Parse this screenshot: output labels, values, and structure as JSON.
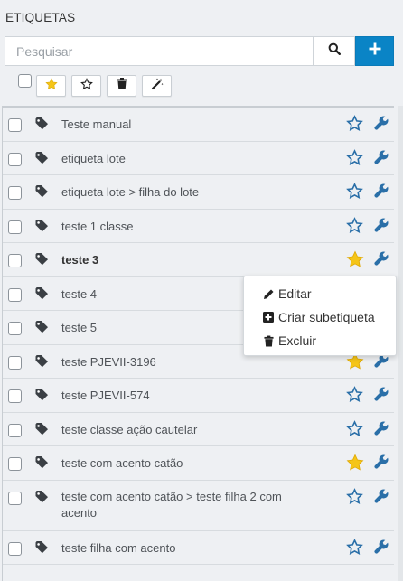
{
  "panel": {
    "title": "ETIQUETAS"
  },
  "search": {
    "placeholder": "Pesquisar",
    "value": ""
  },
  "toolbar": {
    "buttons": [
      {
        "icon": "star-filled-icon"
      },
      {
        "icon": "star-outline-icon"
      },
      {
        "icon": "trash-icon"
      },
      {
        "icon": "magic-wand-icon"
      }
    ]
  },
  "colors": {
    "accent": "#0a84c6",
    "star_filled": "#f5c518",
    "icon_blue": "#2a6fa8",
    "tag_dark": "#3a3f44"
  },
  "tags": [
    {
      "label": "Teste manual",
      "favorite": false,
      "bold": false
    },
    {
      "label": "etiqueta lote",
      "favorite": false,
      "bold": false
    },
    {
      "label": "etiqueta lote > filha do lote",
      "favorite": false,
      "bold": false
    },
    {
      "label": "teste 1 classe",
      "favorite": false,
      "bold": false
    },
    {
      "label": "teste 3",
      "favorite": true,
      "bold": true
    },
    {
      "label": "teste 4",
      "favorite": false,
      "bold": false
    },
    {
      "label": "teste 5",
      "favorite": false,
      "bold": false
    },
    {
      "label": "teste PJEVII-3196",
      "favorite": true,
      "bold": false
    },
    {
      "label": "teste PJEVII-574",
      "favorite": false,
      "bold": false
    },
    {
      "label": "teste classe ação cautelar",
      "favorite": false,
      "bold": false
    },
    {
      "label": "teste com acento catão",
      "favorite": true,
      "bold": false
    },
    {
      "label": "teste com acento catão > teste filha 2 com acento",
      "favorite": false,
      "bold": false
    },
    {
      "label": "teste filha com acento",
      "favorite": false,
      "bold": false
    }
  ],
  "context_menu": {
    "items": [
      {
        "label": "Editar",
        "icon": "pencil-icon"
      },
      {
        "label": "Criar subetiqueta",
        "icon": "plus-square-icon"
      },
      {
        "label": "Excluir",
        "icon": "trash-icon"
      }
    ]
  }
}
